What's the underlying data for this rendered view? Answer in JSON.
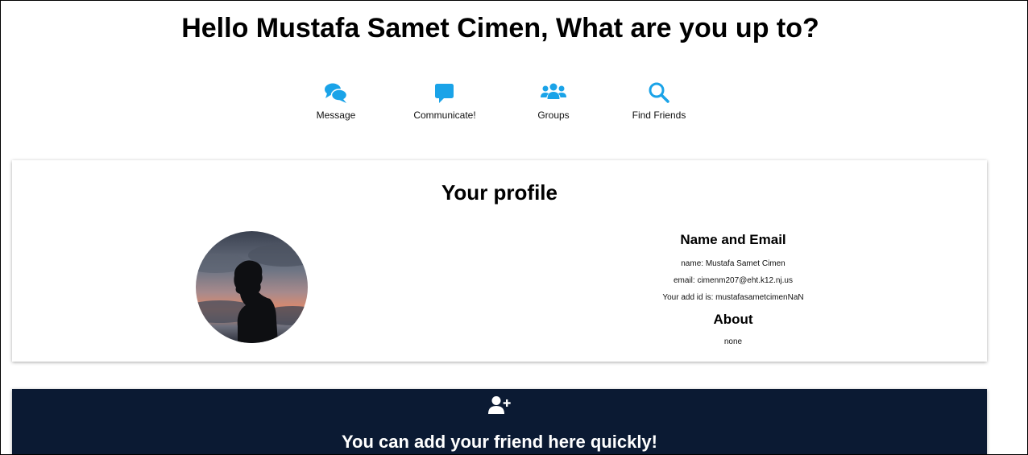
{
  "header": {
    "greeting": "Hello Mustafa Samet Cimen, What are you up to?"
  },
  "nav": {
    "items": [
      {
        "label": "Message",
        "icon": "comments-icon"
      },
      {
        "label": "Communicate!",
        "icon": "chat-bubble-icon"
      },
      {
        "label": "Groups",
        "icon": "users-group-icon"
      },
      {
        "label": "Find Friends",
        "icon": "search-icon"
      }
    ],
    "icon_color": "#1aa3e8"
  },
  "profile": {
    "title": "Your profile",
    "name_email_heading": "Name and Email",
    "name_line": "name: Mustafa Samet Cimen",
    "email_line": "email: cimenm207@eht.k12.nj.us",
    "add_id_line": "Your add id is: mustafasametcimenNaN",
    "about_heading": "About",
    "about_text": "none"
  },
  "add_friend": {
    "title": "You can add your friend here quickly!",
    "icon": "user-plus-icon",
    "background": "#0b1a33"
  }
}
